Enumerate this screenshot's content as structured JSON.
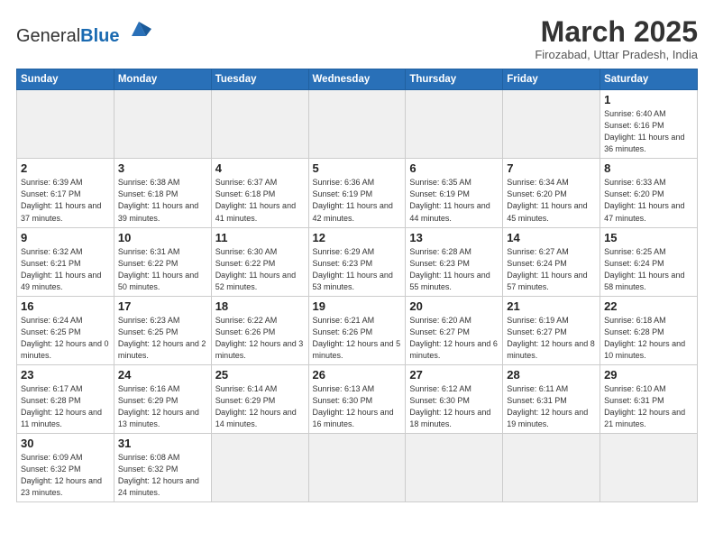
{
  "header": {
    "logo_general": "General",
    "logo_blue": "Blue",
    "title": "March 2025",
    "subtitle": "Firozabad, Uttar Pradesh, India"
  },
  "days_of_week": [
    "Sunday",
    "Monday",
    "Tuesday",
    "Wednesday",
    "Thursday",
    "Friday",
    "Saturday"
  ],
  "weeks": [
    [
      {
        "day": "",
        "info": ""
      },
      {
        "day": "",
        "info": ""
      },
      {
        "day": "",
        "info": ""
      },
      {
        "day": "",
        "info": ""
      },
      {
        "day": "",
        "info": ""
      },
      {
        "day": "",
        "info": ""
      },
      {
        "day": "1",
        "info": "Sunrise: 6:40 AM\nSunset: 6:16 PM\nDaylight: 11 hours\nand 36 minutes."
      }
    ],
    [
      {
        "day": "2",
        "info": "Sunrise: 6:39 AM\nSunset: 6:17 PM\nDaylight: 11 hours\nand 37 minutes."
      },
      {
        "day": "3",
        "info": "Sunrise: 6:38 AM\nSunset: 6:18 PM\nDaylight: 11 hours\nand 39 minutes."
      },
      {
        "day": "4",
        "info": "Sunrise: 6:37 AM\nSunset: 6:18 PM\nDaylight: 11 hours\nand 41 minutes."
      },
      {
        "day": "5",
        "info": "Sunrise: 6:36 AM\nSunset: 6:19 PM\nDaylight: 11 hours\nand 42 minutes."
      },
      {
        "day": "6",
        "info": "Sunrise: 6:35 AM\nSunset: 6:19 PM\nDaylight: 11 hours\nand 44 minutes."
      },
      {
        "day": "7",
        "info": "Sunrise: 6:34 AM\nSunset: 6:20 PM\nDaylight: 11 hours\nand 45 minutes."
      },
      {
        "day": "8",
        "info": "Sunrise: 6:33 AM\nSunset: 6:20 PM\nDaylight: 11 hours\nand 47 minutes."
      }
    ],
    [
      {
        "day": "9",
        "info": "Sunrise: 6:32 AM\nSunset: 6:21 PM\nDaylight: 11 hours\nand 49 minutes."
      },
      {
        "day": "10",
        "info": "Sunrise: 6:31 AM\nSunset: 6:22 PM\nDaylight: 11 hours\nand 50 minutes."
      },
      {
        "day": "11",
        "info": "Sunrise: 6:30 AM\nSunset: 6:22 PM\nDaylight: 11 hours\nand 52 minutes."
      },
      {
        "day": "12",
        "info": "Sunrise: 6:29 AM\nSunset: 6:23 PM\nDaylight: 11 hours\nand 53 minutes."
      },
      {
        "day": "13",
        "info": "Sunrise: 6:28 AM\nSunset: 6:23 PM\nDaylight: 11 hours\nand 55 minutes."
      },
      {
        "day": "14",
        "info": "Sunrise: 6:27 AM\nSunset: 6:24 PM\nDaylight: 11 hours\nand 57 minutes."
      },
      {
        "day": "15",
        "info": "Sunrise: 6:25 AM\nSunset: 6:24 PM\nDaylight: 11 hours\nand 58 minutes."
      }
    ],
    [
      {
        "day": "16",
        "info": "Sunrise: 6:24 AM\nSunset: 6:25 PM\nDaylight: 12 hours\nand 0 minutes."
      },
      {
        "day": "17",
        "info": "Sunrise: 6:23 AM\nSunset: 6:25 PM\nDaylight: 12 hours\nand 2 minutes."
      },
      {
        "day": "18",
        "info": "Sunrise: 6:22 AM\nSunset: 6:26 PM\nDaylight: 12 hours\nand 3 minutes."
      },
      {
        "day": "19",
        "info": "Sunrise: 6:21 AM\nSunset: 6:26 PM\nDaylight: 12 hours\nand 5 minutes."
      },
      {
        "day": "20",
        "info": "Sunrise: 6:20 AM\nSunset: 6:27 PM\nDaylight: 12 hours\nand 6 minutes."
      },
      {
        "day": "21",
        "info": "Sunrise: 6:19 AM\nSunset: 6:27 PM\nDaylight: 12 hours\nand 8 minutes."
      },
      {
        "day": "22",
        "info": "Sunrise: 6:18 AM\nSunset: 6:28 PM\nDaylight: 12 hours\nand 10 minutes."
      }
    ],
    [
      {
        "day": "23",
        "info": "Sunrise: 6:17 AM\nSunset: 6:28 PM\nDaylight: 12 hours\nand 11 minutes."
      },
      {
        "day": "24",
        "info": "Sunrise: 6:16 AM\nSunset: 6:29 PM\nDaylight: 12 hours\nand 13 minutes."
      },
      {
        "day": "25",
        "info": "Sunrise: 6:14 AM\nSunset: 6:29 PM\nDaylight: 12 hours\nand 14 minutes."
      },
      {
        "day": "26",
        "info": "Sunrise: 6:13 AM\nSunset: 6:30 PM\nDaylight: 12 hours\nand 16 minutes."
      },
      {
        "day": "27",
        "info": "Sunrise: 6:12 AM\nSunset: 6:30 PM\nDaylight: 12 hours\nand 18 minutes."
      },
      {
        "day": "28",
        "info": "Sunrise: 6:11 AM\nSunset: 6:31 PM\nDaylight: 12 hours\nand 19 minutes."
      },
      {
        "day": "29",
        "info": "Sunrise: 6:10 AM\nSunset: 6:31 PM\nDaylight: 12 hours\nand 21 minutes."
      }
    ],
    [
      {
        "day": "30",
        "info": "Sunrise: 6:09 AM\nSunset: 6:32 PM\nDaylight: 12 hours\nand 23 minutes."
      },
      {
        "day": "31",
        "info": "Sunrise: 6:08 AM\nSunset: 6:32 PM\nDaylight: 12 hours\nand 24 minutes."
      },
      {
        "day": "",
        "info": ""
      },
      {
        "day": "",
        "info": ""
      },
      {
        "day": "",
        "info": ""
      },
      {
        "day": "",
        "info": ""
      },
      {
        "day": "",
        "info": ""
      }
    ]
  ]
}
